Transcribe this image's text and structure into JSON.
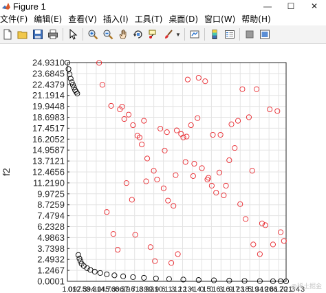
{
  "window": {
    "title": "Figure 1",
    "controls": {
      "minimize": "—",
      "maximize": "☐",
      "close": "✕"
    }
  },
  "menu": {
    "items": [
      "文件(F)",
      "编辑(E)",
      "查看(V)",
      "插入(I)",
      "工具(T)",
      "桌面(D)",
      "窗口(W)",
      "帮助(H)"
    ]
  },
  "toolbar": {
    "buttons": [
      "new-figure-icon",
      "open-file-icon",
      "save-icon",
      "print-icon",
      "pointer-arrow-icon",
      "zoom-in-icon",
      "zoom-out-icon",
      "pan-hand-icon",
      "rotate-3d-icon",
      "data-cursor-icon",
      "brush-icon",
      "link-plot-icon",
      "colorbar-icon",
      "legend-icon",
      "hide-plot-tools-icon",
      "show-plot-tools-icon"
    ]
  },
  "watermark": "@稀土掘金",
  "chart_data": {
    "type": "scatter",
    "ylabel": "f2",
    "xlabel": "",
    "ylim": [
      0.0001,
      24.931
    ],
    "xlim": [
      1,
      21
    ],
    "y_ticks": [
      "0.0001",
      "1.2467",
      "2.4932",
      "3.7398",
      "4.9863",
      "6.2328",
      "7.4794",
      "8.7259",
      "9.9725",
      "11.2190",
      "12.4656",
      "13.7121",
      "14.9587",
      "16.2052",
      "17.4517",
      "18.6983",
      "19.9448",
      "21.1914",
      "22.4379",
      "23.6845",
      "24.9310"
    ],
    "x_tick_labels_visible": [
      "1.0",
      "01",
      "97",
      "2.3",
      "59",
      "3.3",
      "4.0",
      "14",
      "4.7",
      "5.3",
      "60",
      "6.3",
      "6.9",
      "7.6",
      "7.",
      "13",
      "8.9",
      "9.3",
      "9.9",
      "10",
      "6",
      "11",
      "3",
      "12",
      "12",
      "13",
      "4",
      "14",
      "0",
      "15",
      "0",
      "16",
      "3",
      "16",
      "9",
      "17",
      "23",
      "18",
      "5",
      "19",
      "34",
      "19",
      "20",
      "61",
      "6.7",
      "20",
      "21",
      "3",
      "4",
      "3"
    ],
    "grid": true,
    "series": [
      {
        "marker": "circle",
        "color": "#000000",
        "x": [
          1.0,
          1.1,
          1.2,
          1.3,
          1.4,
          1.5,
          1.6,
          1.7,
          1.8,
          1.9,
          2.0,
          2.1,
          2.2,
          2.3,
          2.5,
          2.8,
          3.1,
          3.5,
          4.0,
          4.6,
          5.3,
          6.1,
          7.0,
          8.0,
          9.1,
          10.3,
          11.6,
          13.0,
          14.4,
          15.8,
          17.2,
          18.6,
          19.8,
          20.5,
          21.0
        ],
        "y": [
          24.93,
          24.2,
          23.6,
          23.1,
          22.7,
          22.4,
          22.1,
          21.8,
          21.6,
          21.4,
          3.0,
          2.6,
          2.3,
          2.0,
          1.75,
          1.5,
          1.3,
          1.1,
          0.95,
          0.8,
          0.68,
          0.57,
          0.48,
          0.4,
          0.33,
          0.26,
          0.2,
          0.15,
          0.11,
          0.08,
          0.05,
          0.03,
          0.015,
          0.006,
          0.0001
        ]
      },
      {
        "marker": "circle",
        "color": "#e8242a",
        "x": [
          3.9,
          5.0,
          5.6,
          6.0,
          6.2,
          7.0,
          7.4,
          7.8,
          8.3,
          8.9,
          9.2,
          9.8,
          10.2,
          10.7,
          11.0,
          11.4,
          11.9,
          12.3,
          12.9,
          13.3,
          13.8,
          14.2,
          14.6,
          15.3,
          16.0,
          16.8,
          17.3,
          18.0,
          18.8,
          19.5,
          20.2,
          20.8,
          4.2,
          5.8,
          6.6,
          8.0,
          9.5,
          10.1,
          11.6,
          12.0,
          13.0,
          13.6,
          14.9,
          15.8,
          16.3,
          17.6,
          18.3,
          19.1,
          20.5,
          4.6,
          5.2,
          6.9,
          7.2,
          8.6,
          9.0,
          10.5,
          11.1,
          12.6,
          14.3,
          15.0,
          16.6,
          17.0,
          18.6,
          19.8,
          7.6,
          9.9,
          12.5,
          13.9,
          15.5,
          17.9,
          11.8,
          10.9,
          8.2,
          6.4
        ],
        "y": [
          24.9,
          20.0,
          3.6,
          19.9,
          18.5,
          17.8,
          16.6,
          15.6,
          14.0,
          12.6,
          11.6,
          10.6,
          9.2,
          8.6,
          17.2,
          16.8,
          16.5,
          17.8,
          18.6,
          12.9,
          11.6,
          10.9,
          10.1,
          9.8,
          17.9,
          8.8,
          7.1,
          4.2,
          6.6,
          19.6,
          19.4,
          4.6,
          22.4,
          19.6,
          19.0,
          18.3,
          17.4,
          17.0,
          16.4,
          23.0,
          23.2,
          22.8,
          12.4,
          13.8,
          15.2,
          18.7,
          21.9,
          6.4,
          5.6,
          7.9,
          5.4,
          9.3,
          5.3,
          3.9,
          2.3,
          2.1,
          3.1,
          13.4,
          16.7,
          16.7,
          18.3,
          21.9,
          3.1,
          4.2,
          16.4,
          14.9,
          12.0,
          11.8,
          10.9,
          12.6,
          13.6,
          12.1,
          11.4,
          11.2
        ]
      }
    ]
  }
}
